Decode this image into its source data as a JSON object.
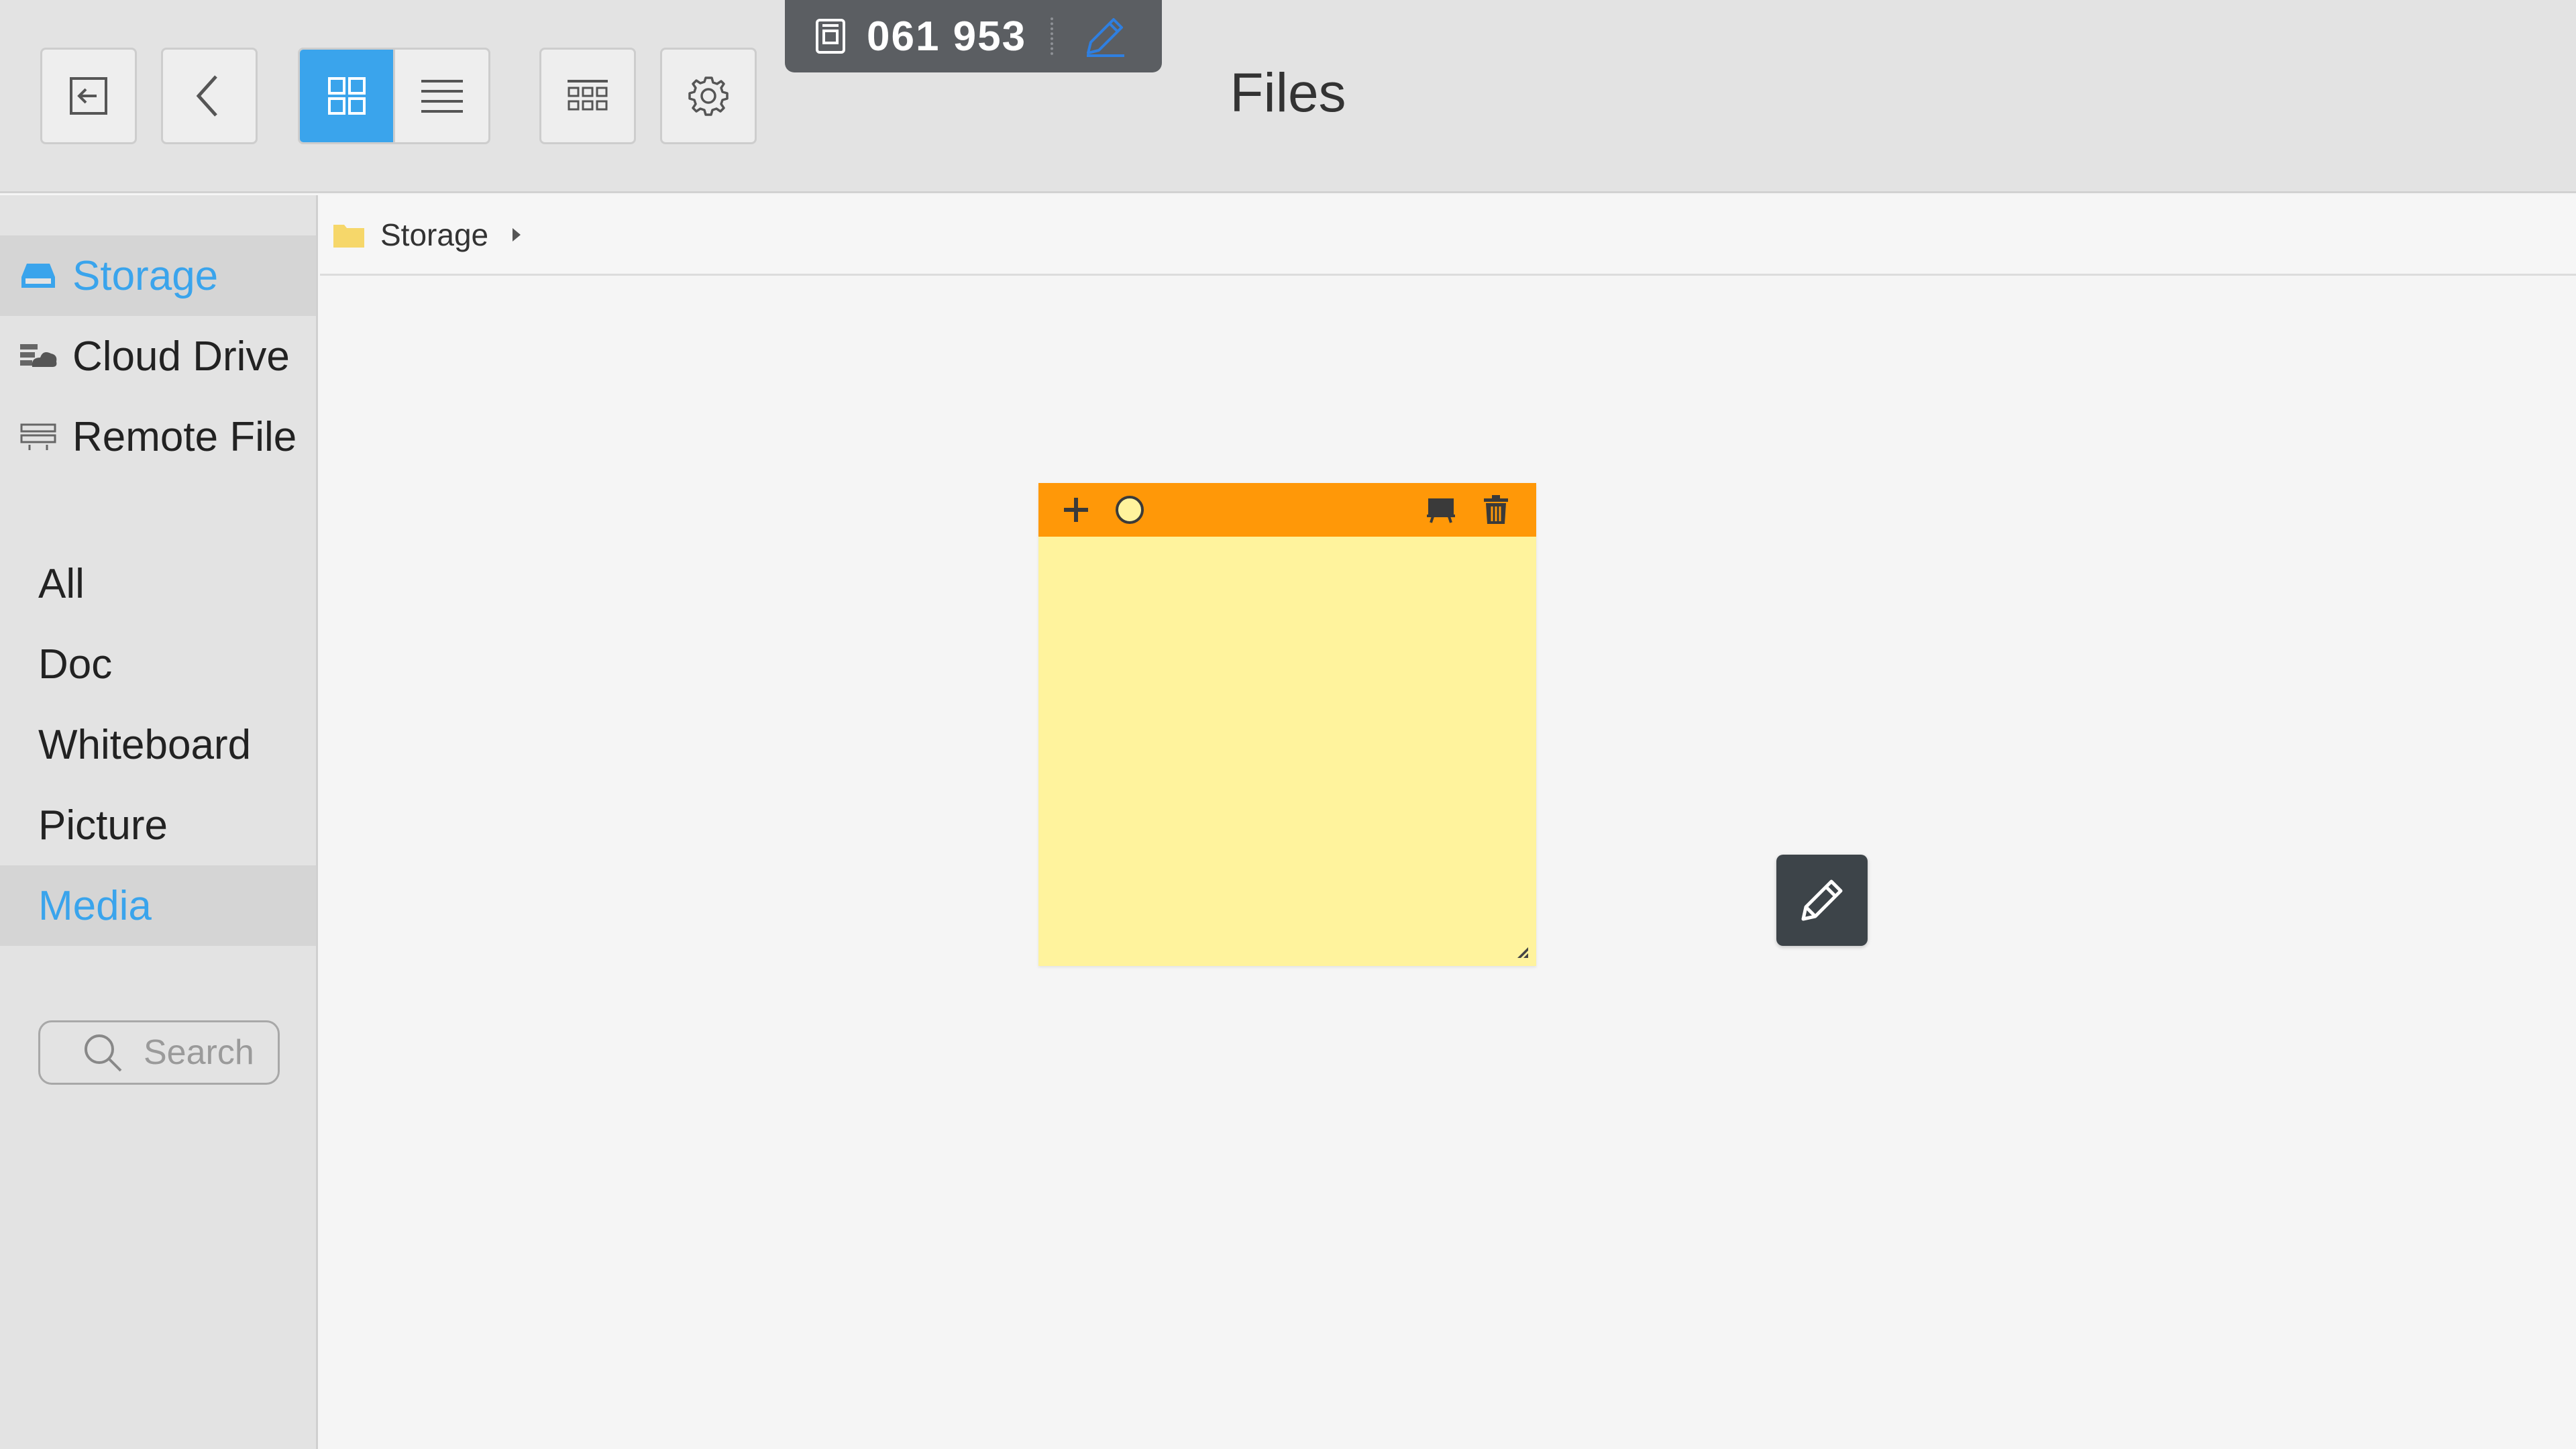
{
  "app": {
    "title": "Files"
  },
  "meeting": {
    "code": "061 953",
    "icon": "screen-share-icon",
    "pen_icon": "pen-icon"
  },
  "toolbar": {
    "exit_icon": "exit-icon",
    "back_icon": "chevron-left-icon",
    "grid_view_icon": "grid-view-icon",
    "list_view_icon": "list-view-icon",
    "multi_select_icon": "multi-select-icon",
    "settings_icon": "gear-icon",
    "active_view": "grid"
  },
  "sidebar": {
    "locations": [
      {
        "label": "Storage",
        "icon": "storage-icon",
        "selected": true
      },
      {
        "label": "Cloud Drive",
        "icon": "cloud-drive-icon",
        "selected": false
      },
      {
        "label": "Remote File",
        "icon": "remote-file-icon",
        "selected": false
      }
    ],
    "categories": [
      {
        "label": "All",
        "selected": false
      },
      {
        "label": "Doc",
        "selected": false
      },
      {
        "label": "Whiteboard",
        "selected": false
      },
      {
        "label": "Picture",
        "selected": false
      },
      {
        "label": "Media",
        "selected": true
      }
    ],
    "search": {
      "placeholder": "Search"
    }
  },
  "breadcrumb": {
    "items": [
      "Storage"
    ]
  },
  "sticky_note": {
    "text": "",
    "toolbar_icons": [
      "plus-icon",
      "color-circle-icon",
      "board-icon",
      "trash-icon"
    ]
  },
  "colors": {
    "accent": "#3aa4ec",
    "note_bar": "#ff9808",
    "note_body": "#fff39d",
    "pill": "#5b5e62"
  }
}
